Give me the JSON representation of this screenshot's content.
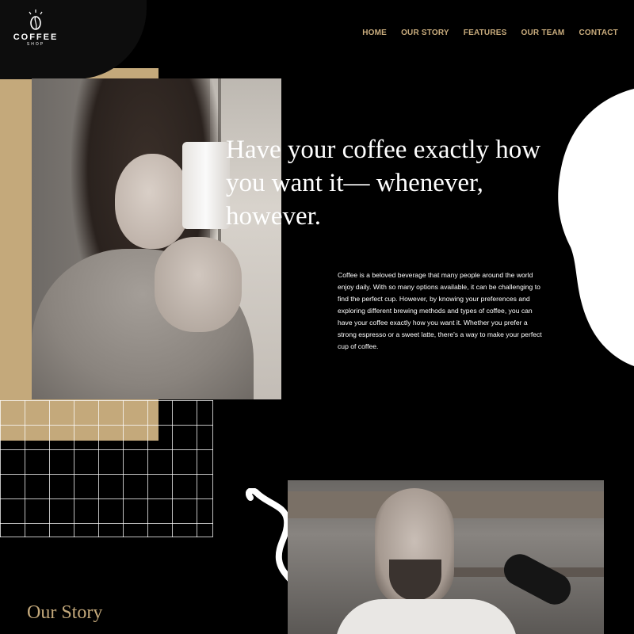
{
  "brand": {
    "name": "COFFEE",
    "tagline": "SHOP"
  },
  "nav": {
    "items": [
      {
        "label": "HOME"
      },
      {
        "label": "OUR STORY"
      },
      {
        "label": "FEATURES"
      },
      {
        "label": "OUR TEAM"
      },
      {
        "label": "CONTACT"
      }
    ]
  },
  "hero": {
    "headline": "Have your coffee exactly how you want it— whenever, however.",
    "body": "Coffee is a beloved beverage that many people around the world enjoy daily. With so many options available, it can be challenging to find the perfect cup. However, by knowing your preferences and exploring different brewing methods and types of coffee, you can have your coffee exactly how you want it. Whether you prefer a strong espresso or a sweet latte, there's a way to make your perfect cup of coffee."
  },
  "story": {
    "heading": "Our Story"
  },
  "colors": {
    "background": "#000000",
    "accent_tan": "#c4a97b",
    "nav_text": "#c9ac7d",
    "text": "#ffffff"
  },
  "icons": {
    "logo": "coffee-bean-icon"
  }
}
